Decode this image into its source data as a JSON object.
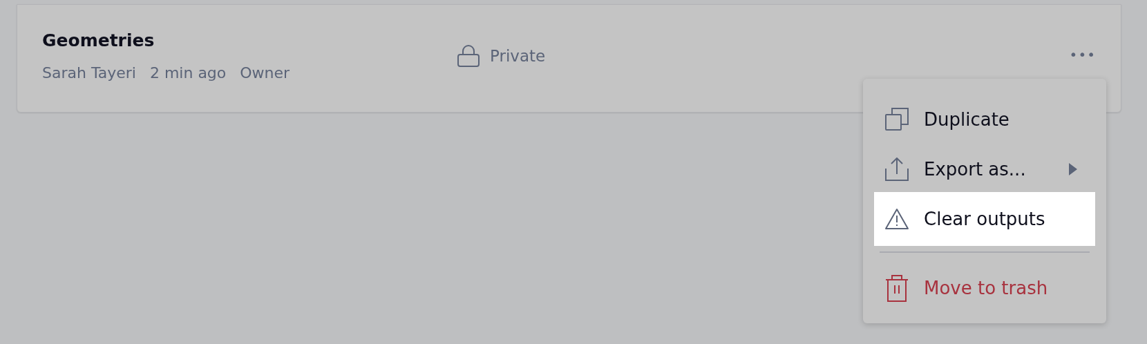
{
  "card": {
    "title": "Geometries",
    "meta": [
      "Sarah Tayeri",
      "2 min ago",
      "Owner"
    ],
    "visibility": "Private",
    "more": "•••"
  },
  "menu": [
    {
      "label": "Duplicate",
      "kind": "plain",
      "selected": false
    },
    {
      "label": "Export as...",
      "kind": "submenu",
      "selected": false
    },
    {
      "label": "Clear outputs",
      "kind": "plain",
      "selected": true
    },
    {
      "label": "Move to trash",
      "kind": "danger",
      "selected": false
    }
  ]
}
